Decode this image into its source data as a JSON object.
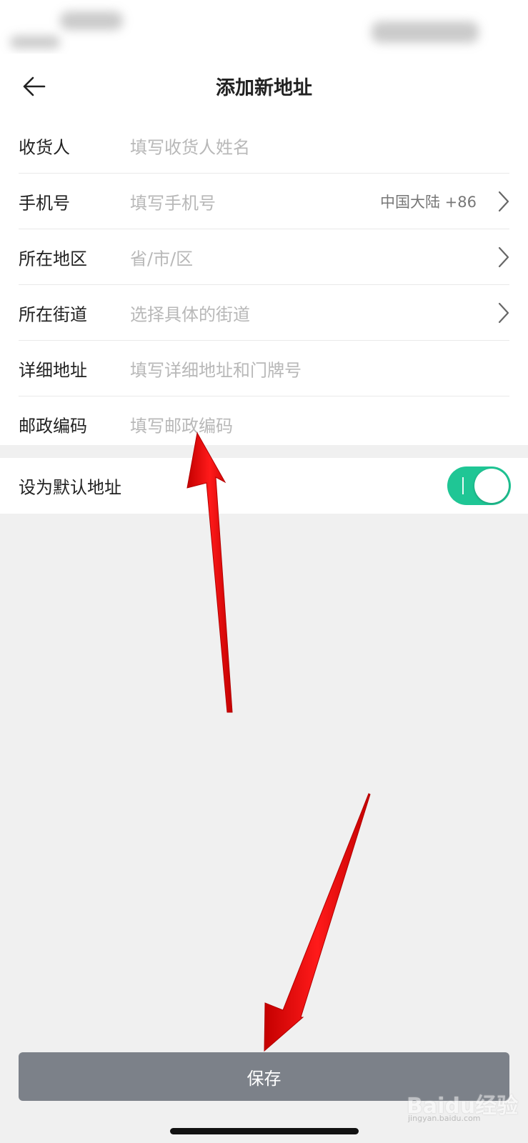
{
  "header": {
    "title": "添加新地址"
  },
  "form": {
    "rows": [
      {
        "label": "收货人",
        "placeholder": "填写收货人姓名"
      },
      {
        "label": "手机号",
        "placeholder": "填写手机号",
        "extra": "中国大陆 +86"
      },
      {
        "label": "所在地区",
        "placeholder": "省/市/区"
      },
      {
        "label": "所在街道",
        "placeholder": "选择具体的街道"
      },
      {
        "label": "详细地址",
        "placeholder": "填写详细地址和门牌号"
      },
      {
        "label": "邮政编码",
        "placeholder": "填写邮政编码"
      }
    ]
  },
  "default_address": {
    "label": "设为默认地址",
    "enabled": true
  },
  "footer": {
    "save_label": "保存"
  },
  "watermark": {
    "main": "Baidu经验",
    "sub": "jingyan.baidu.com"
  },
  "colors": {
    "toggle_on": "#1fc695",
    "save_button": "#7c8189",
    "annotation_arrow": "#ff0000",
    "page_bg": "#f0f0f0"
  },
  "icons": {
    "back": "arrow-left-icon",
    "chevron": "chevron-right-icon"
  }
}
